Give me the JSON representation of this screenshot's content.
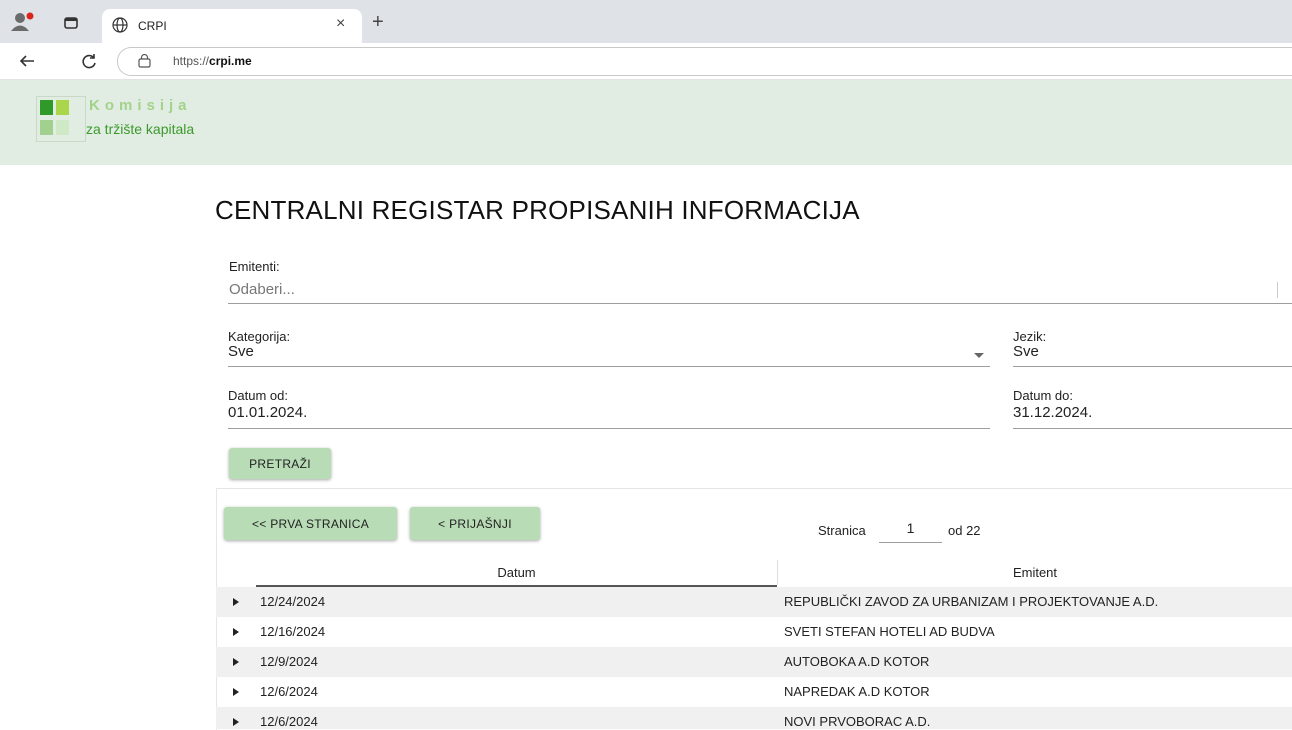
{
  "browser": {
    "tab_title": "CRPI",
    "tab_close": "×",
    "new_tab": "+",
    "url_prefix": "https://",
    "url_domain": "crpi.me"
  },
  "logo": {
    "line1": "Komisija",
    "line2": "za tržište kapitala",
    "colors": [
      "#2f9a2a",
      "#a9d64a",
      "#a2d08f",
      "#dcefd3"
    ]
  },
  "page": {
    "title": "CENTRALNI REGISTAR PROPISANIH INFORMACIJA"
  },
  "form": {
    "emitenti_label": "Emitenti:",
    "emitenti_placeholder": "Odaberi...",
    "kategorija_label": "Kategorija:",
    "kategorija_value": "Sve",
    "jezik_label": "Jezik:",
    "jezik_value": "Sve",
    "datum_od_label": "Datum od:",
    "datum_od_value": "01.01.2024.",
    "datum_do_label": "Datum do:",
    "datum_do_value": "31.12.2024.",
    "search_button": "PRETRAŽI"
  },
  "pager": {
    "first_button": "<< PRVA STRANICA",
    "prev_button": "< PRIJAŠNJI",
    "page_label": "Stranica",
    "page_value": "1",
    "of_label": "od 22"
  },
  "table": {
    "columns": [
      "Datum",
      "Emitent"
    ],
    "rows": [
      {
        "datum": "12/24/2024",
        "emitent": "REPUBLIČKI ZAVOD ZA URBANIZAM I PROJEKTOVANJE A.D."
      },
      {
        "datum": "12/16/2024",
        "emitent": "SVETI STEFAN HOTELI AD BUDVA"
      },
      {
        "datum": "12/9/2024",
        "emitent": "AUTOBOKA A.D KOTOR"
      },
      {
        "datum": "12/6/2024",
        "emitent": "NAPREDAK A.D KOTOR"
      },
      {
        "datum": "12/6/2024",
        "emitent": "NOVI PRVOBORAC A.D."
      }
    ]
  },
  "colors": {
    "header_bg": "#e1ece3",
    "button_bg": "#b8dcb5",
    "tabstrip_bg": "#dfe3e8"
  },
  "icons": [
    "profile-icon",
    "tab-actions-icon",
    "globe-icon",
    "back-icon",
    "reload-icon",
    "site-info-icon",
    "triangle-expand-icon",
    "chevron-down-icon"
  ]
}
